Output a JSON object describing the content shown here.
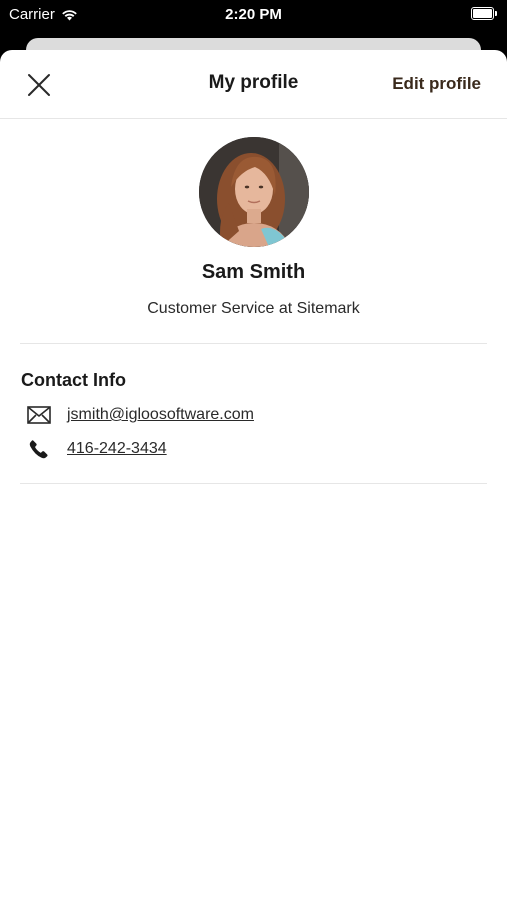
{
  "status_bar": {
    "carrier": "Carrier",
    "time": "2:20 PM"
  },
  "nav": {
    "title": "My profile",
    "edit_label": "Edit profile"
  },
  "profile": {
    "name": "Sam Smith",
    "role": "Customer Service at Sitemark"
  },
  "contact": {
    "title": "Contact Info",
    "email": "jsmith@igloosoftware.com",
    "phone": "416-242-3434"
  },
  "colors": {
    "accent": "#3a2a1c",
    "text": "#1a1a1a",
    "divider": "#e6e6e6"
  },
  "icons": [
    "wifi-icon",
    "battery-icon",
    "close-icon",
    "mail-icon",
    "phone-icon"
  ]
}
